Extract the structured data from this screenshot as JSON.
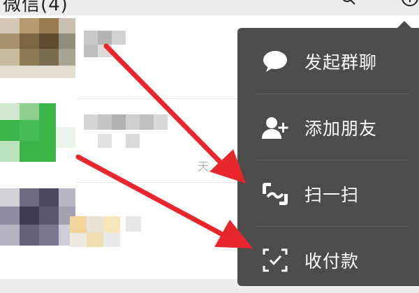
{
  "topbar": {
    "title": "微信(4)"
  },
  "chat_list": {
    "time_fragment": "天"
  },
  "menu": {
    "items": [
      {
        "label": "发起群聊",
        "icon": "chat-bubble-icon"
      },
      {
        "label": "添加朋友",
        "icon": "add-friend-icon"
      },
      {
        "label": "扫一扫",
        "icon": "scan-icon"
      },
      {
        "label": "收付款",
        "icon": "payment-icon"
      }
    ]
  },
  "colors": {
    "menu_bg": "#4c4c4c",
    "menu_text": "#ffffff",
    "arrow": "#e8262b",
    "wechat_green": "#3bb44a"
  }
}
